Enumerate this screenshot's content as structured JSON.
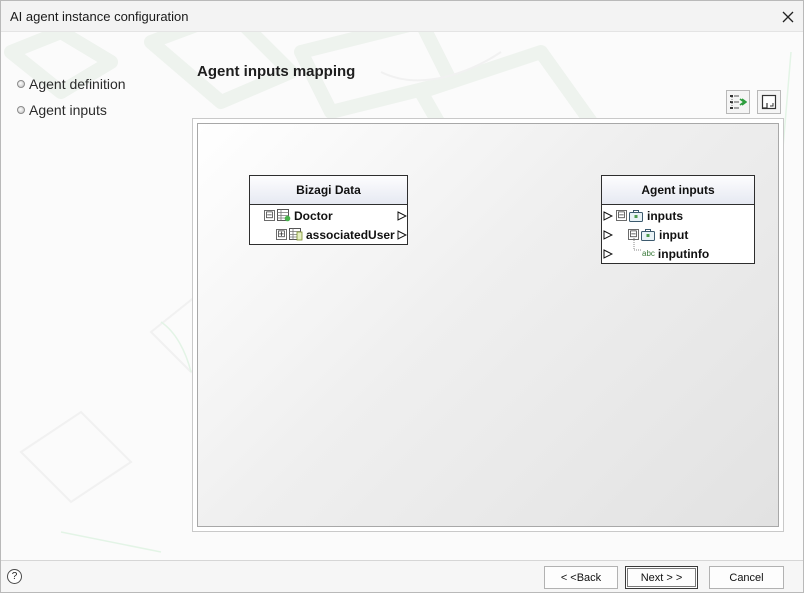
{
  "window": {
    "title": "AI agent instance configuration"
  },
  "nav": {
    "items": [
      {
        "label": "Agent definition"
      },
      {
        "label": "Agent inputs"
      }
    ]
  },
  "section": {
    "title": "Agent inputs mapping"
  },
  "toolbar": {
    "icons": [
      "auto-map-icon",
      "fit-view-icon"
    ]
  },
  "source_node": {
    "title": "Bizagi Data",
    "rows": [
      {
        "label": "Doctor",
        "expander": "⊟",
        "icon": "entity-icon"
      },
      {
        "label": "associatedUser",
        "expander": "⊞",
        "icon": "entity-icon"
      }
    ]
  },
  "target_node": {
    "title": "Agent inputs",
    "rows": [
      {
        "label": "inputs",
        "expander": "⊟",
        "icon": "briefcase-icon"
      },
      {
        "label": "input",
        "expander": "⊟",
        "icon": "briefcase-icon"
      },
      {
        "label": "inputinfo",
        "icon": "text-attribute-icon",
        "icon_text": "abc"
      }
    ]
  },
  "footer": {
    "help": "?",
    "back_label": "< <Back",
    "next_label": "Next > >",
    "cancel_label": "Cancel"
  }
}
